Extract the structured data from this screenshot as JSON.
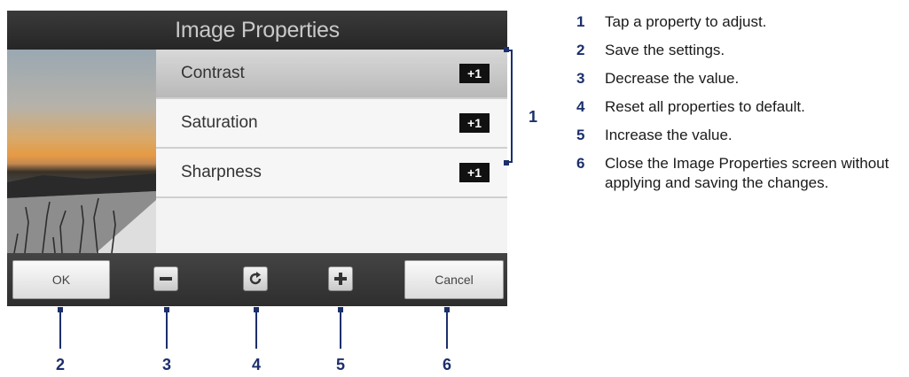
{
  "screen": {
    "title": "Image Properties",
    "properties": [
      {
        "label": "Contrast",
        "value": "+1",
        "selected": true
      },
      {
        "label": "Saturation",
        "value": "+1",
        "selected": false
      },
      {
        "label": "Sharpness",
        "value": "+1",
        "selected": false
      }
    ],
    "buttons": {
      "ok_label": "OK",
      "decrease_icon": "minus-icon",
      "reset_icon": "refresh-icon",
      "increase_icon": "plus-icon",
      "cancel_label": "Cancel"
    }
  },
  "callouts": [
    "1",
    "2",
    "3",
    "4",
    "5",
    "6"
  ],
  "legend": [
    {
      "num": "1",
      "text": "Tap a property to adjust."
    },
    {
      "num": "2",
      "text": "Save the settings."
    },
    {
      "num": "3",
      "text": "Decrease the value."
    },
    {
      "num": "4",
      "text": "Reset all properties to default."
    },
    {
      "num": "5",
      "text": "Increase the value."
    },
    {
      "num": "6",
      "text": "Close the Image Properties screen without applying and saving the changes."
    }
  ],
  "colors": {
    "callout": "#1c2f6c",
    "selected_row": "#c4c4c4",
    "value_badge": "#111111"
  }
}
